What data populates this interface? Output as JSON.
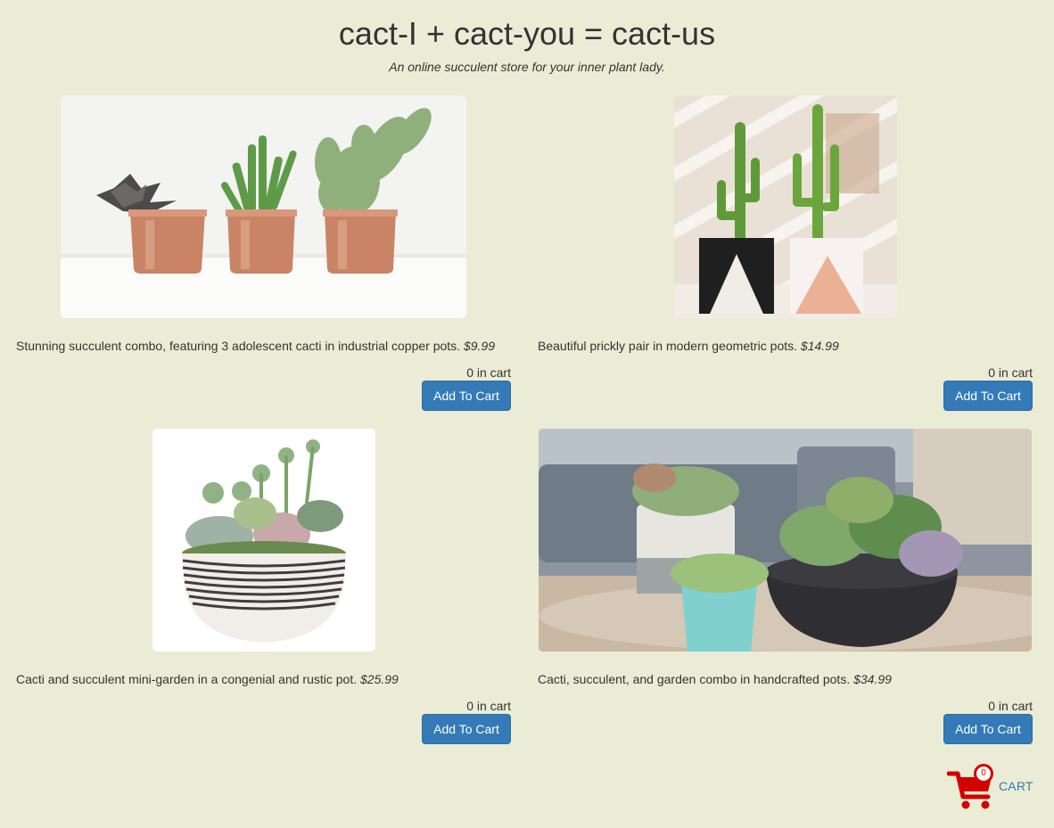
{
  "header": {
    "title": "cact-I + cact-you = cact-us",
    "subtitle": "An online succulent store for your inner plant lady."
  },
  "products": [
    {
      "description": "Stunning succulent combo, featuring 3 adolescent cacti in industrial copper pots.",
      "price": "$9.99",
      "in_cart": "0 in cart",
      "button_label": "Add To Cart",
      "image": "copper-pots-cacti-photo"
    },
    {
      "description": "Beautiful prickly pair in modern geometric pots.",
      "price": "$14.99",
      "in_cart": "0 in cart",
      "button_label": "Add To Cart",
      "image": "geometric-pots-cacti-photo"
    },
    {
      "description": "Cacti and succulent mini-garden in a congenial and rustic pot.",
      "price": "$25.99",
      "in_cart": "0 in cart",
      "button_label": "Add To Cart",
      "image": "striped-bowl-garden-photo"
    },
    {
      "description": "Cacti, succulent, and garden combo in handcrafted pots.",
      "price": "$34.99",
      "in_cart": "0 in cart",
      "button_label": "Add To Cart",
      "image": "handcrafted-pots-succulents-photo"
    }
  ],
  "cart": {
    "label": "CART",
    "count": "0",
    "icon": "shopping-cart-icon"
  },
  "colors": {
    "background": "#ebecd5",
    "button": "#337ab7",
    "cart_icon": "#d40000"
  }
}
